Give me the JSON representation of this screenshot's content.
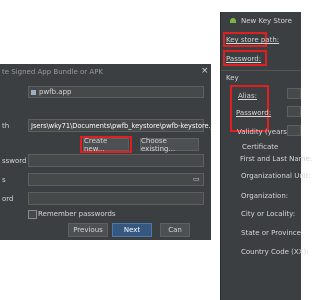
{
  "left_dialog": {
    "title": "te Signed App Bundle or APK",
    "module_value": "pwfb.app",
    "path_label": "th",
    "path_value": "Jsers\\wky71\\Documents\\pwfb_keystore\\pwfb-keystore.jks",
    "create_new": "Create new...",
    "choose_existing": "Choose existing...",
    "password_label": "ssword",
    "alias_label": "s",
    "key_password_label": "ord",
    "remember": "Remember passwords",
    "previous": "Previous",
    "next": "Next",
    "cancel": "Can",
    "colors": {
      "accent": "#365880",
      "highlight": "#e02020",
      "bg": "#3c3f41"
    }
  },
  "right_dialog": {
    "title": "New Key Store",
    "key_store_path": "Key store path:",
    "password": "Password:",
    "key_section": "Key",
    "alias": "Alias:",
    "key_password": "Password:",
    "validity": "Validity (years):",
    "certificate": "Certificate",
    "first_last_name": "First and Last Name:",
    "org_unit": "Organizational Unit:",
    "organization": "Organization:",
    "city": "City or Locality:",
    "state": "State or Province:",
    "country": "Country Code (XX):"
  }
}
